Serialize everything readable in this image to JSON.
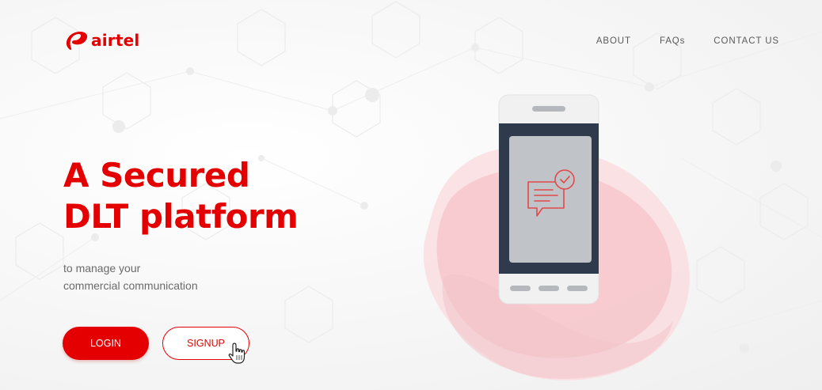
{
  "header": {
    "logo": {
      "icon": "airtel-swirl-icon",
      "text": "airtel"
    },
    "nav": [
      {
        "label": "ABOUT"
      },
      {
        "label": "FAQs"
      },
      {
        "label": "CONTACT US"
      }
    ]
  },
  "hero": {
    "title_line1": "A Secured",
    "title_line2": "DLT platform",
    "subtitle_line1": "to manage your",
    "subtitle_line2": "commercial communication",
    "login_label": "LOGIN",
    "signup_label": "SIGNUP"
  },
  "illustration": {
    "icons": [
      "smartphone-icon",
      "message-verified-icon",
      "hand-pointer-cursor-icon"
    ]
  },
  "colors": {
    "brand": "#e40000",
    "text_muted": "#6a6a6a",
    "phone_frame": "#2f3b4c",
    "phone_screen": "#c0c3c7",
    "blob": "#f7c9cd"
  }
}
